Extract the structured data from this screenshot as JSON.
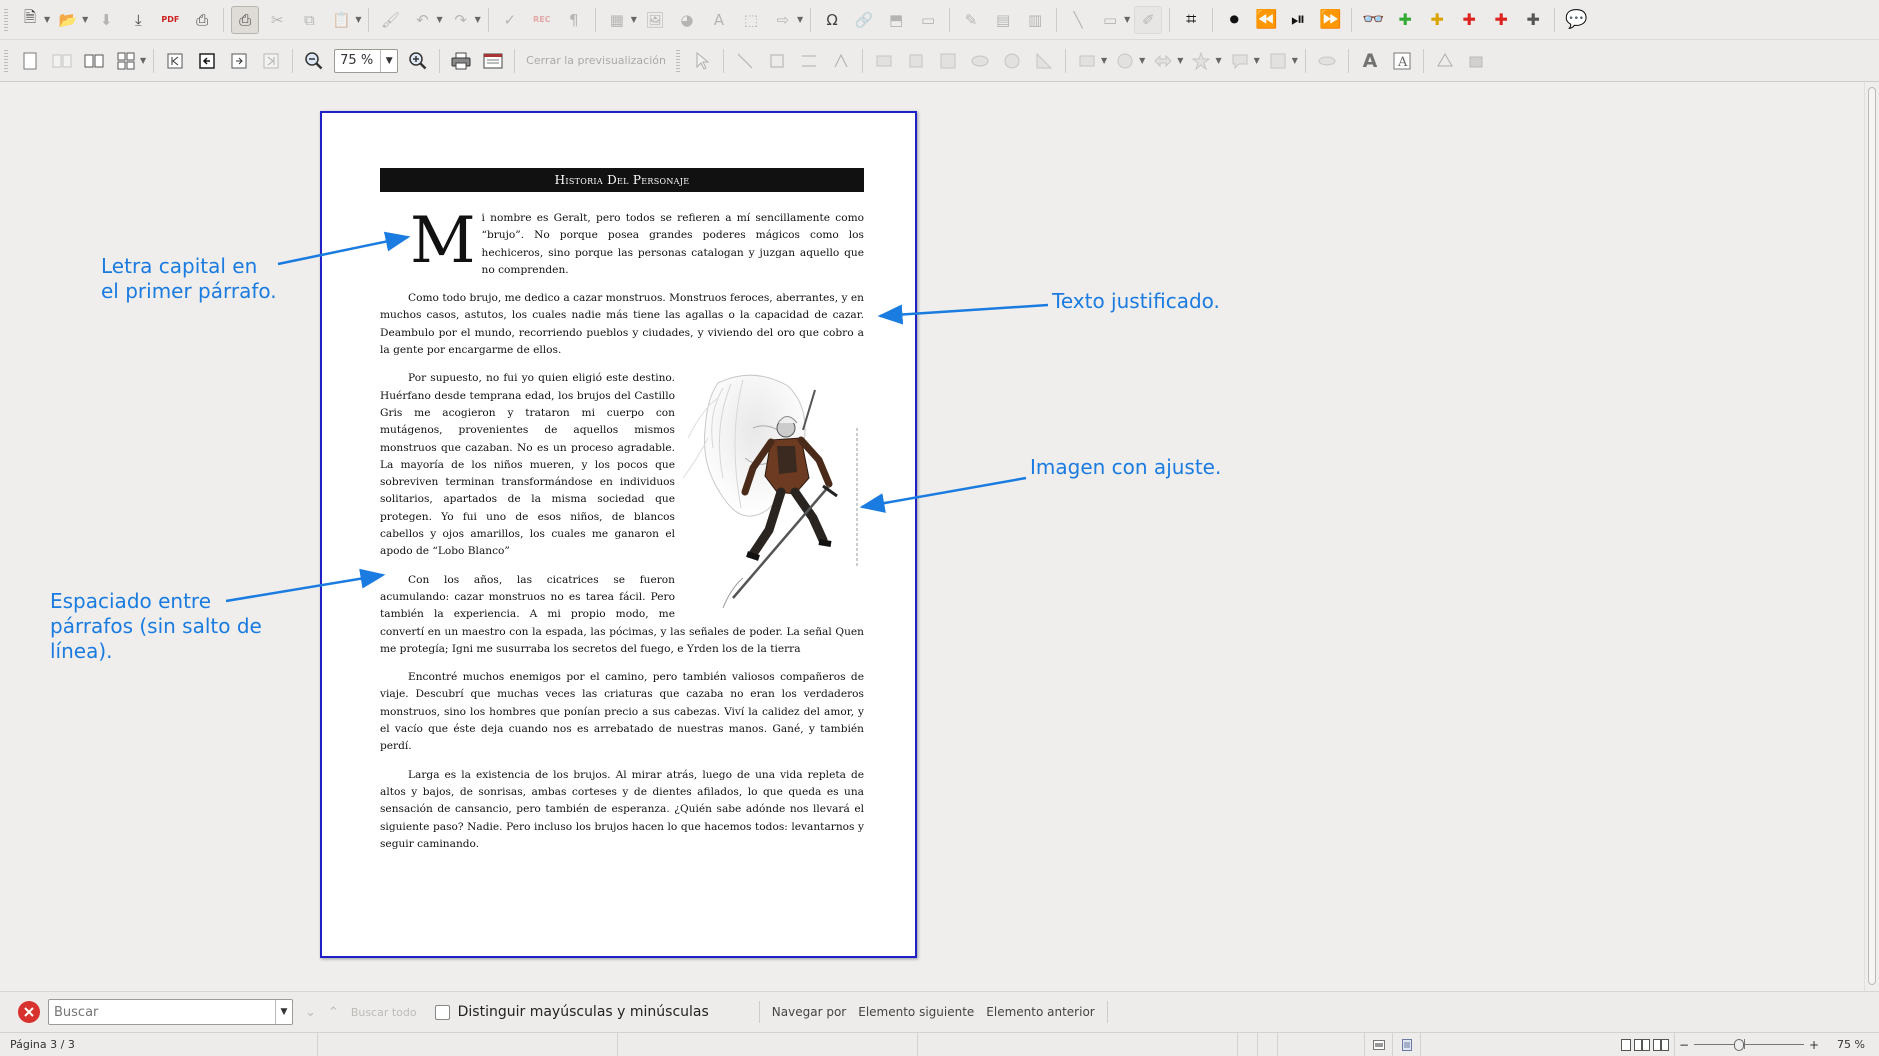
{
  "toolbar_standard": {
    "items": [
      {
        "icon": "new-document-icon",
        "glyph": "🗎",
        "dim": false,
        "dropdown": true
      },
      {
        "icon": "open-folder-icon",
        "glyph": "📂",
        "dim": false,
        "dropdown": true
      },
      {
        "icon": "save-icon",
        "glyph": "⬇",
        "dim": true
      },
      {
        "icon": "export-icon",
        "glyph": "⤓",
        "dim": false
      },
      {
        "icon": "export-pdf-icon",
        "glyph": "PDF",
        "dim": false
      },
      {
        "icon": "print-icon",
        "glyph": "⎙",
        "dim": false
      },
      {
        "icon": "print-preview-icon",
        "glyph": "⎙",
        "dim": false,
        "pressed": true
      },
      {
        "icon": "cut-icon",
        "glyph": "✂",
        "dim": true
      },
      {
        "icon": "copy-icon",
        "glyph": "⧉",
        "dim": true
      },
      {
        "icon": "paste-icon",
        "glyph": "📋",
        "dim": true,
        "dropdown": true
      },
      {
        "icon": "clone-formatting-icon",
        "glyph": "🖌",
        "dim": true
      },
      {
        "icon": "undo-icon",
        "glyph": "↶",
        "dim": true,
        "dropdown": true
      },
      {
        "icon": "redo-icon",
        "glyph": "↷",
        "dim": true,
        "dropdown": true
      },
      {
        "icon": "spellcheck-icon",
        "glyph": "✓",
        "dim": true
      },
      {
        "icon": "record-changes-icon",
        "glyph": "REC",
        "dim": true
      },
      {
        "icon": "formatting-marks-icon",
        "glyph": "¶",
        "dim": true
      },
      {
        "icon": "table-icon",
        "glyph": "▦",
        "dim": true,
        "dropdown": true
      },
      {
        "icon": "image-icon",
        "glyph": "🖼",
        "dim": true
      },
      {
        "icon": "chart-icon",
        "glyph": "◕",
        "dim": true
      },
      {
        "icon": "fontwork-icon",
        "glyph": "A",
        "dim": true
      },
      {
        "icon": "frame-icon",
        "glyph": "⬚",
        "dim": true
      },
      {
        "icon": "field-icon",
        "glyph": "⇨",
        "dim": true,
        "dropdown": true
      },
      {
        "icon": "special-character-icon",
        "glyph": "Ω",
        "dim": false
      },
      {
        "icon": "hyperlink-icon",
        "glyph": "🔗",
        "dim": true
      },
      {
        "icon": "footnote-icon",
        "glyph": "⬒",
        "dim": true
      },
      {
        "icon": "comment-icon",
        "glyph": "▭",
        "dim": true
      },
      {
        "icon": "track-changes-icon",
        "glyph": "✎",
        "dim": true
      },
      {
        "icon": "header-icon",
        "glyph": "▤",
        "dim": true
      },
      {
        "icon": "footer-icon",
        "glyph": "▥",
        "dim": true
      },
      {
        "icon": "line-icon",
        "glyph": "╲",
        "dim": true
      },
      {
        "icon": "shapes-icon",
        "glyph": "▭",
        "dim": true,
        "dropdown": true
      },
      {
        "icon": "show-draw-functions-icon",
        "glyph": "✐",
        "dim": true,
        "pressed": true
      },
      {
        "icon": "crop-icon",
        "glyph": "⌗",
        "dim": false
      },
      {
        "icon": "screen-record-icon",
        "glyph": "⏺",
        "dim": false
      },
      {
        "icon": "rewind-icon",
        "glyph": "⏪",
        "dim": false
      },
      {
        "icon": "play-pause-icon",
        "glyph": "⏯",
        "dim": false
      },
      {
        "icon": "fast-forward-icon",
        "glyph": "⏩",
        "dim": false
      },
      {
        "icon": "binoculars-icon",
        "glyph": "👓",
        "dim": false
      },
      {
        "icon": "extension-green-icon",
        "glyph": "✚",
        "dim": false
      },
      {
        "icon": "extension-yellow-icon",
        "glyph": "✚",
        "dim": false
      },
      {
        "icon": "extension-red-icon",
        "glyph": "✚",
        "dim": false
      },
      {
        "icon": "extension-red2-icon",
        "glyph": "✚",
        "dim": false
      },
      {
        "icon": "extension-doc-icon",
        "glyph": "✚",
        "dim": false
      },
      {
        "icon": "speech-bubble-icon",
        "glyph": "💬",
        "dim": false
      }
    ]
  },
  "toolbar_preview": {
    "zoom_value": "75 %",
    "close_preview_label": "Cerrar la previsualización"
  },
  "document": {
    "title": "Historia Del Personaje",
    "dropcap": "M",
    "paragraphs": [
      "i nombre es Geralt, pero todos se refieren a mí sencillamente como “brujo”. No porque posea grandes poderes mágicos como los hechiceros, sino porque las personas catalogan y juzgan aquello que no comprenden.",
      "Como todo brujo, me dedico a cazar monstruos. Monstruos feroces, aberrantes, y en muchos casos, astutos, los cuales nadie más tiene las agallas o la capacidad de cazar. Deambulo por el mundo, recorriendo pueblos y ciudades, y viviendo del oro que cobro a la gente por encargarme de ellos.",
      "Por supuesto, no fui yo quien eligió este destino. Huérfano desde temprana edad, los brujos del Castillo Gris me acogieron y trataron mi cuerpo con mutágenos, provenientes de aquellos mismos monstruos que cazaban. No es un proceso agradable. La mayoría de los niños mueren, y los pocos que sobreviven terminan transformándose en individuos solitarios, apartados de la misma sociedad que protegen. Yo fui uno de esos niños, de blancos cabellos y ojos amarillos, los cuales me ganaron el apodo de “Lobo Blanco”",
      "Con los años, las cicatrices se fueron acumulando: cazar monstruos no es tarea fácil. Pero también la experiencia. A mi propio modo, me convertí en un maestro con la espada, las pócimas, y las señales de poder. La señal Quen me protegía; Igni me susurraba los secretos del fuego, e Yrden los de la tierra",
      "Encontré muchos enemigos por el camino, pero también valiosos compañeros de viaje. Descubrí que muchas veces las criaturas que cazaba no eran los verdaderos monstruos, sino los hombres que ponían precio a sus cabezas. Viví la calidez del amor, y el vacío que éste deja cuando nos es arrebatado de nuestras manos. Gané, y también perdí.",
      "Larga es la existencia de los brujos. Al mirar atrás, luego de una vida repleta de altos y bajos, de sonrisas, ambas corteses y de dientes afilados, lo que queda es una sensación de cansancio, pero también de esperanza. ¿Quién sabe adónde nos llevará el siguiente paso? Nadie. Pero incluso los brujos hacen lo que hacemos todos: levantarnos y seguir caminando."
    ]
  },
  "annotations": [
    {
      "id": "dropcap",
      "text": "Letra capital en\nel primer párrafo."
    },
    {
      "id": "justified",
      "text": "Texto justificado."
    },
    {
      "id": "image",
      "text": "Imagen con ajuste."
    },
    {
      "id": "spacing",
      "text": "Espaciado entre\npárrafos (sin salto de\nlínea)."
    }
  ],
  "findbar": {
    "search_placeholder": "Buscar",
    "find_all_label": "Buscar todo",
    "match_case_label": "Distinguir mayúsculas y minúsculas",
    "navigate_by_label": "Navegar por",
    "next_element_label": "Elemento siguiente",
    "prev_element_label": "Elemento anterior"
  },
  "statusbar": {
    "page_info": "Página 3 / 3",
    "zoom_percent": "75 %"
  },
  "colors": {
    "accent_annotation": "#1a7be0",
    "page_border": "#2020c8",
    "title_bar": "#111111"
  }
}
